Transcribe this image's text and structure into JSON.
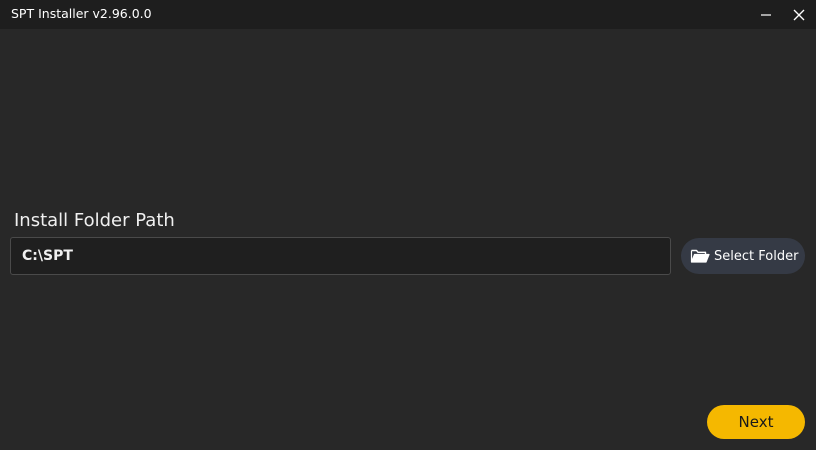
{
  "window": {
    "title": "SPT Installer v2.96.0.0"
  },
  "install": {
    "label": "Install Folder Path",
    "path_value": "C:\\SPT",
    "select_folder_label": "Select Folder"
  },
  "footer": {
    "next_label": "Next"
  },
  "icons": {
    "minimize": "minimize-icon",
    "close": "close-icon",
    "folder": "folder-open-icon"
  },
  "colors": {
    "background": "#282828",
    "titlebar": "#1e1e1e",
    "accent": "#f5b800",
    "select_button": "#353a45"
  }
}
